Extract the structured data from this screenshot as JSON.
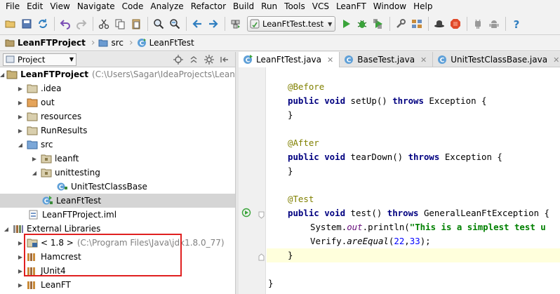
{
  "menu": [
    {
      "label": "File",
      "u": "F",
      "rest": "ile"
    },
    {
      "label": "Edit",
      "u": "E",
      "rest": "dit"
    },
    {
      "label": "View",
      "u": "V",
      "rest": "iew"
    },
    {
      "label": "Navigate",
      "u": "N",
      "rest": "avigate"
    },
    {
      "label": "Code",
      "u": "C",
      "rest": "ode"
    },
    {
      "label": "Analyze",
      "u": "",
      "pre": "Analy",
      "u2": "z",
      "rest": "e"
    },
    {
      "label": "Refactor",
      "u": "R",
      "rest": "efactor"
    },
    {
      "label": "Build",
      "u": "B",
      "rest": "uild"
    },
    {
      "label": "Run",
      "u": "R",
      "rest": "un",
      "pre2": ""
    },
    {
      "label": "Tools",
      "u": "T",
      "rest": "ools"
    },
    {
      "label": "VCS",
      "pre": "VC",
      "u2": "S",
      "rest": ""
    },
    {
      "label": "LeanFT"
    },
    {
      "label": "Window",
      "u": "W",
      "rest": "indow"
    },
    {
      "label": "Help",
      "u": "H",
      "rest": "elp"
    }
  ],
  "toolbar": {
    "run_config": "LeanFtTest.test",
    "icons": [
      "save-icon",
      "save-all-icon",
      "sync-icon",
      "undo-icon",
      "redo-icon",
      "cut-icon",
      "copy-icon",
      "paste-icon",
      "find-icon",
      "replace-icon",
      "back-icon",
      "forward-icon",
      "build-icon",
      "run-icon",
      "debug-icon",
      "coverage-icon",
      "settings-icon",
      "structure-icon",
      "hat-icon",
      "ruby-icon",
      "android-device-icon",
      "android-sdk-icon",
      "help-icon"
    ]
  },
  "breadcrumb": {
    "project": "LeanFTProject",
    "folder": "src",
    "file": "LeanFtTest"
  },
  "project_panel": {
    "selector_label": "Project",
    "tree": [
      {
        "label": "LeanFTProject",
        "path": "(C:\\Users\\Sagar\\IdeaProjects\\LeanFTProje",
        "bold": true
      },
      {
        "label": ".idea"
      },
      {
        "label": "out"
      },
      {
        "label": "resources"
      },
      {
        "label": "RunResults"
      },
      {
        "label": "src"
      },
      {
        "label": "leanft"
      },
      {
        "label": "unittesting"
      },
      {
        "label": "UnitTestClassBase"
      },
      {
        "label": "LeanFtTest"
      },
      {
        "label": "LeanFTProject.iml"
      },
      {
        "label": "External Libraries"
      },
      {
        "label": "< 1.8 >",
        "path": "(C:\\Program Files\\Java\\jdk1.8.0_77)"
      },
      {
        "label": "Hamcrest"
      },
      {
        "label": "JUnit4"
      },
      {
        "label": "LeanFT"
      }
    ]
  },
  "tabs": [
    {
      "label": "LeanFtTest.java",
      "active": true
    },
    {
      "label": "BaseTest.java",
      "active": false
    },
    {
      "label": "UnitTestClassBase.java",
      "active": false
    }
  ],
  "code": {
    "l1": "@Before",
    "l2a": "public void",
    "l2b": " setUp() ",
    "l2c": "throws",
    "l2d": " Exception {",
    "l3": "}",
    "l4": "@After",
    "l5a": "public void",
    "l5b": " tearDown() ",
    "l5c": "throws",
    "l5d": " Exception {",
    "l6": "}",
    "l7": "@Test",
    "l8a": "public void",
    "l8b": " test() ",
    "l8c": "throws",
    "l8d": " GeneralLeanFtException {",
    "l9a": "System.",
    "l9b": "out",
    "l9c": ".println(",
    "l9d": "\"This is a simplest test u",
    "l10a": "Verify.",
    "l10b": "areEqual",
    "l10c": "(",
    "l10d": "22",
    "l10e": ",",
    "l10f": "33",
    "l10g": ");",
    "l11": "}",
    "l12": "}"
  }
}
